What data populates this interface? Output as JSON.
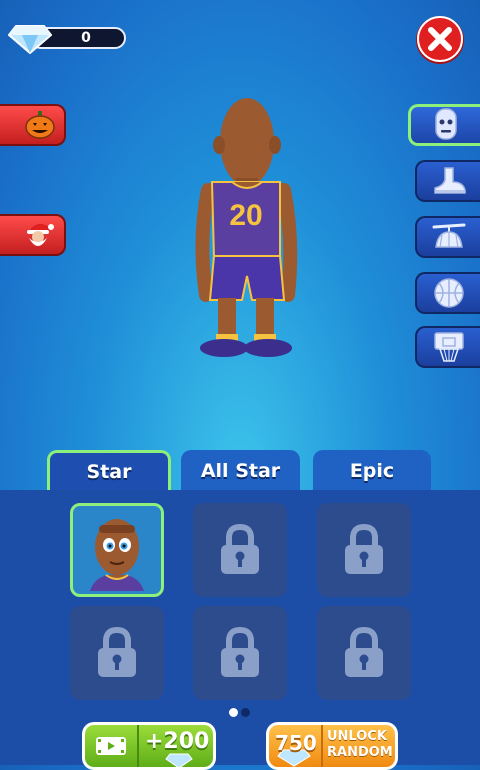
{
  "currency": {
    "gems": "0"
  },
  "tabs": [
    {
      "label": "Star",
      "active": true
    },
    {
      "label": "All Star",
      "active": false
    },
    {
      "label": "Epic",
      "active": false
    }
  ],
  "player": {
    "jersey_number": "20",
    "jersey_color": "#5a3fa0",
    "trim_color": "#f5c340"
  },
  "left_buttons": [
    {
      "icon": "pumpkin-icon"
    },
    {
      "icon": "santa-icon"
    }
  ],
  "right_buttons": [
    {
      "icon": "head-icon",
      "active": true
    },
    {
      "icon": "shoe-icon"
    },
    {
      "icon": "propeller-hat-icon"
    },
    {
      "icon": "basketball-icon"
    },
    {
      "icon": "hoop-icon"
    }
  ],
  "grid": {
    "cells": [
      {
        "state": "selected",
        "icon": "player-portrait"
      },
      {
        "state": "locked",
        "icon": "lock-icon"
      },
      {
        "state": "locked",
        "icon": "lock-icon"
      },
      {
        "state": "locked",
        "icon": "lock-icon"
      },
      {
        "state": "locked",
        "icon": "lock-icon"
      },
      {
        "state": "locked",
        "icon": "lock-icon"
      }
    ],
    "page": 1,
    "pages": 2
  },
  "actions": {
    "video_reward_label": "+200",
    "unlock_price": "750",
    "unlock_label_line1": "UNLOCK",
    "unlock_label_line2": "RANDOM"
  },
  "colors": {
    "accent_green": "#8cf07a",
    "close_red": "#e02020",
    "panel_blue": "#1c4ea8"
  }
}
